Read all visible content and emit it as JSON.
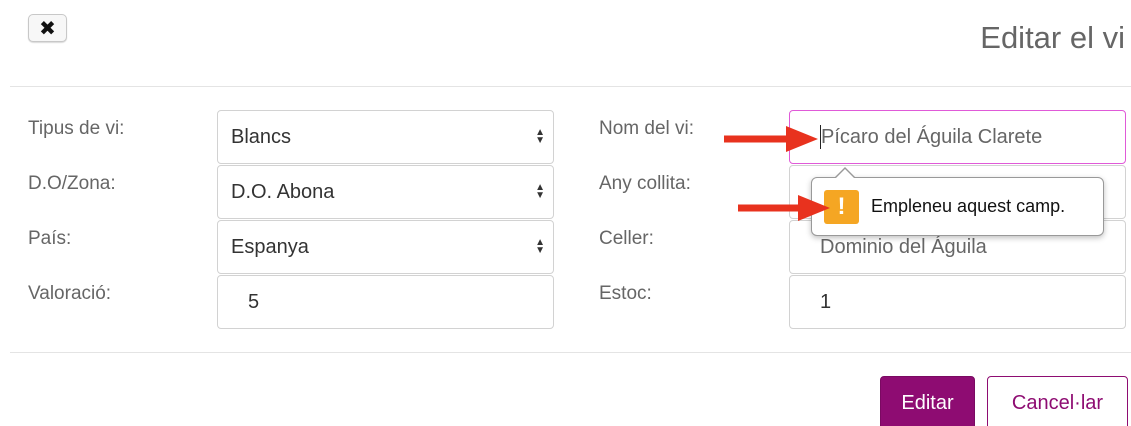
{
  "header": {
    "close_label": "✖",
    "title": "Editar el vi"
  },
  "form": {
    "left": [
      {
        "label": "Tipus de vi:",
        "value": "Blancs"
      },
      {
        "label": "D.O/Zona:",
        "value": "D.O. Abona"
      },
      {
        "label": "País:",
        "value": "Espanya"
      },
      {
        "label": "Valoració:",
        "value": "5"
      }
    ],
    "right": [
      {
        "label": "Nom del vi:",
        "value": "Pícaro del Águila Clarete"
      },
      {
        "label": "Any collita:",
        "value": ""
      },
      {
        "label": "Celler:",
        "value": "Dominio del Águila"
      },
      {
        "label": "Estoc:",
        "value": "1"
      }
    ]
  },
  "tooltip": {
    "icon": "!",
    "message": "Empleneu aquest camp."
  },
  "buttons": {
    "submit_label": "Editar",
    "cancel_label": "Cancel·lar"
  },
  "colors": {
    "accent": "#8e0c72",
    "focus_border": "#e05ad8",
    "warning": "#f5a623",
    "annotation_arrow": "#e8321e"
  }
}
